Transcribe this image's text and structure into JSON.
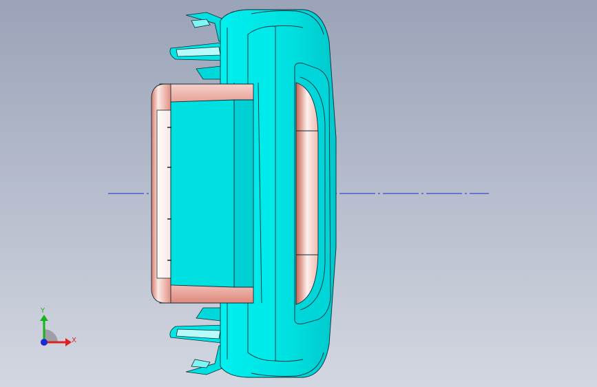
{
  "viewport": {
    "background_top": "#9aa3b8",
    "background_bottom": "#d3d7e1"
  },
  "model": {
    "primary_color": "#00e5e5",
    "primary_shade": "#00b8c0",
    "highlight_color": "#f6c9c1",
    "highlight_shade": "#d9786b",
    "edge_color": "#0a2a33"
  },
  "centerline": {
    "color": "#1a2bd6"
  },
  "triad": {
    "x_label": "X",
    "y_label": "Y",
    "x_color": "#e02020",
    "y_color": "#19b219",
    "z_color": "#1a2bd6"
  }
}
